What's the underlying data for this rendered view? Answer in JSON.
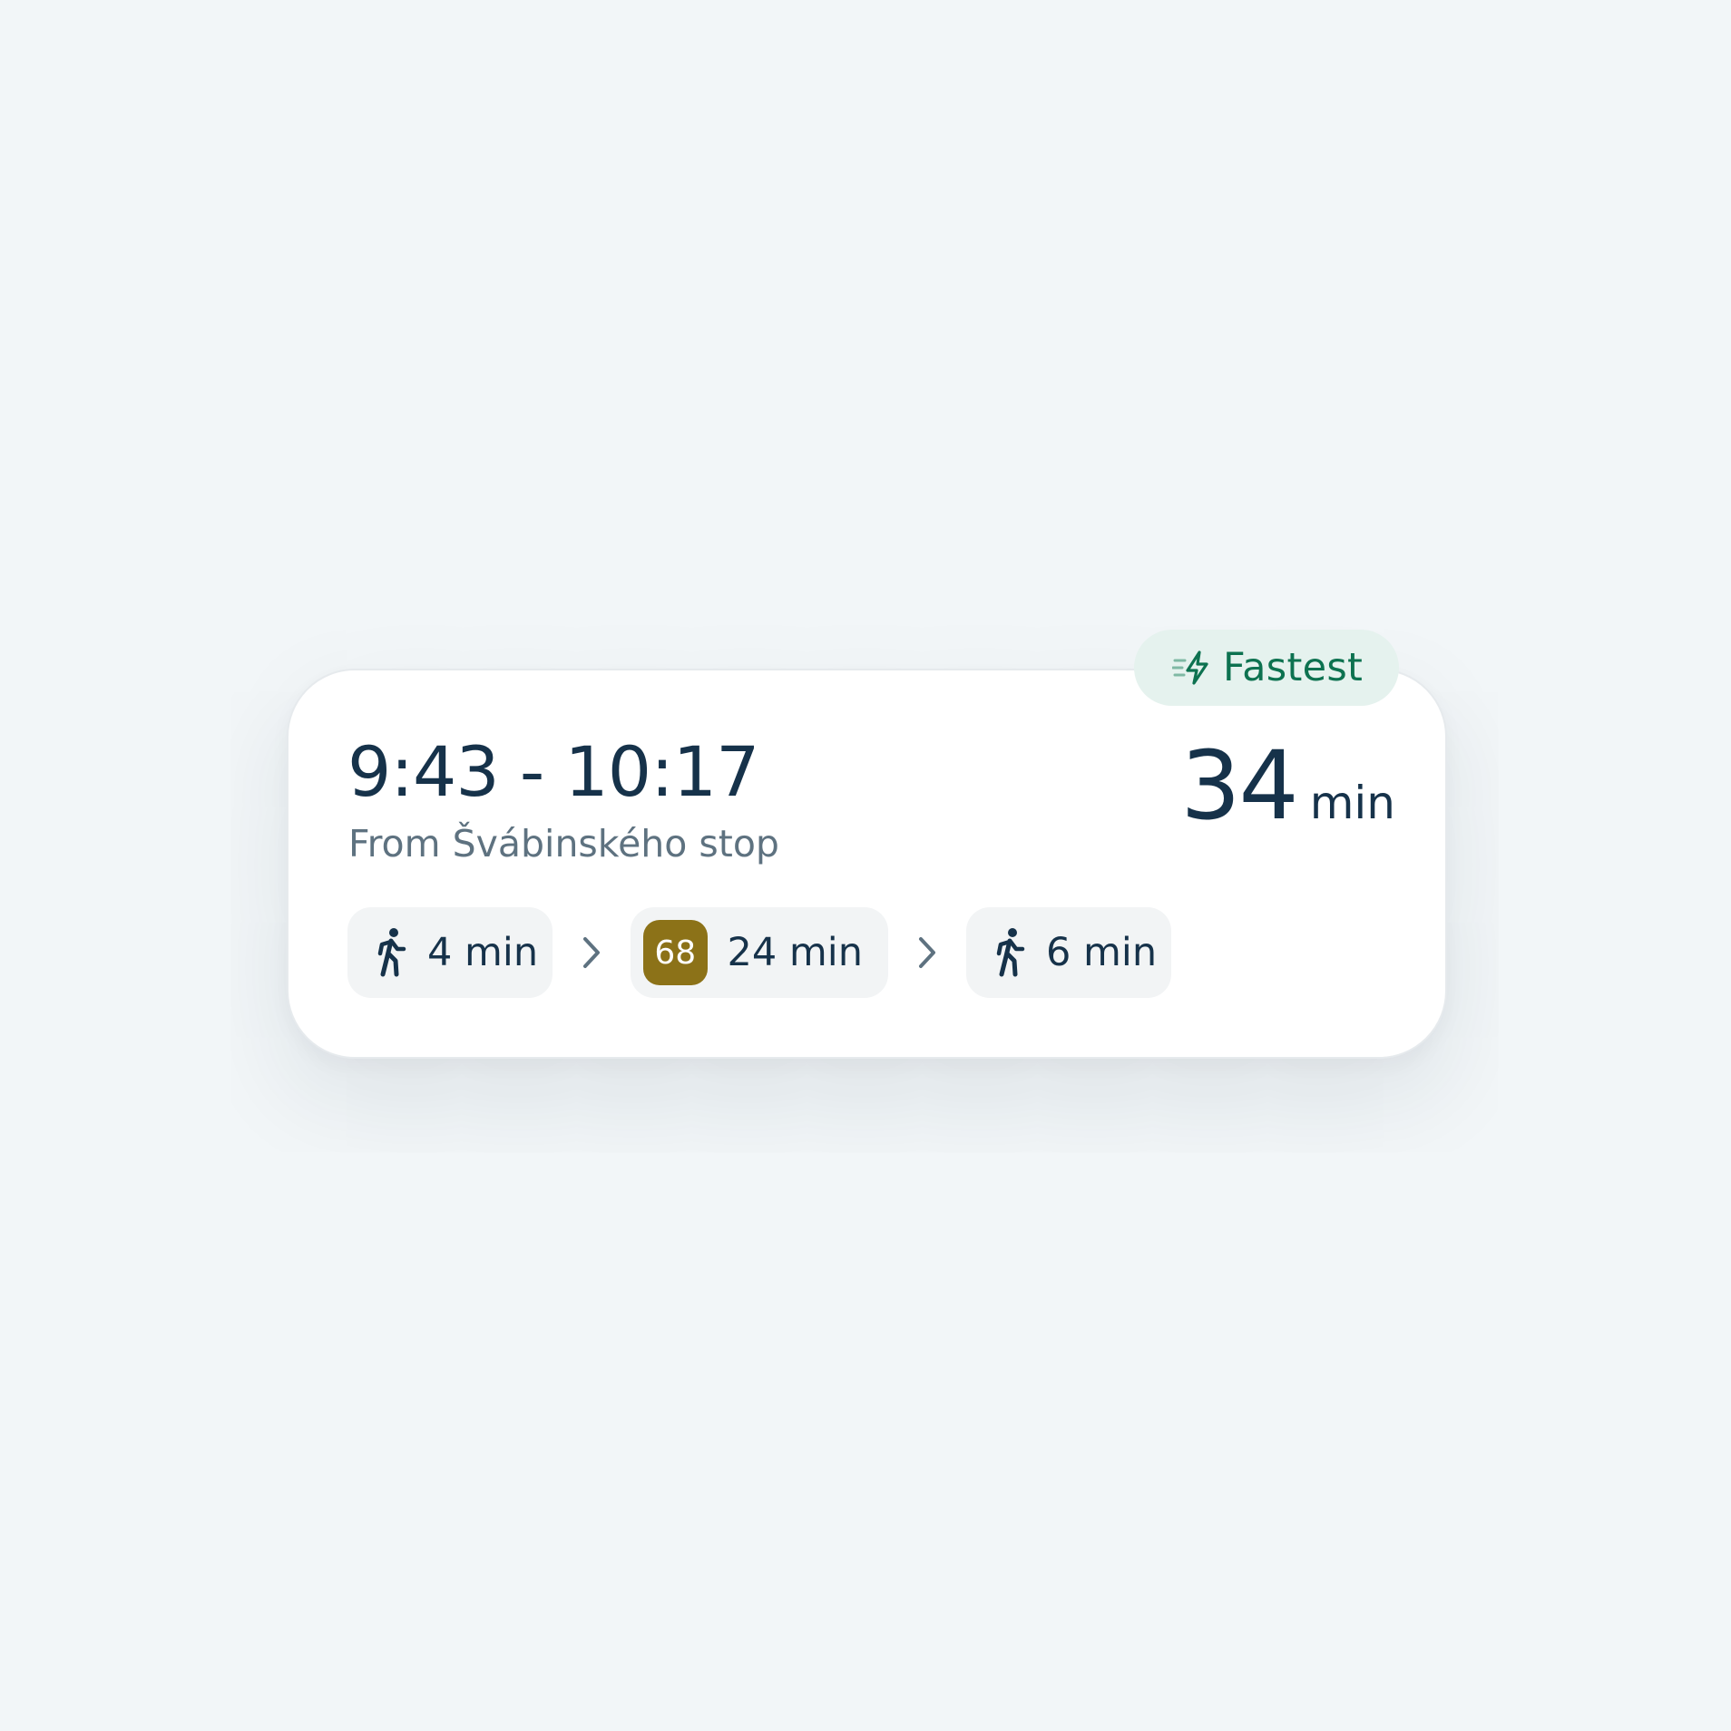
{
  "badge": {
    "label": "Fastest",
    "icon": "lightning-fast-icon",
    "color": "#0d7250",
    "background": "#e5f2ee"
  },
  "trip": {
    "time_range": "9:43 - 10:17",
    "origin": "From Švábinského stop",
    "duration_value": "34",
    "duration_unit": "min"
  },
  "segments": [
    {
      "type": "walk",
      "icon": "walk-icon",
      "text": "4 min"
    },
    {
      "type": "transit",
      "line": "68",
      "line_color": "#8c7218",
      "text": "24 min"
    },
    {
      "type": "walk",
      "icon": "walk-icon",
      "text": "6 min"
    }
  ],
  "separator_icon": "chevron-right-icon"
}
